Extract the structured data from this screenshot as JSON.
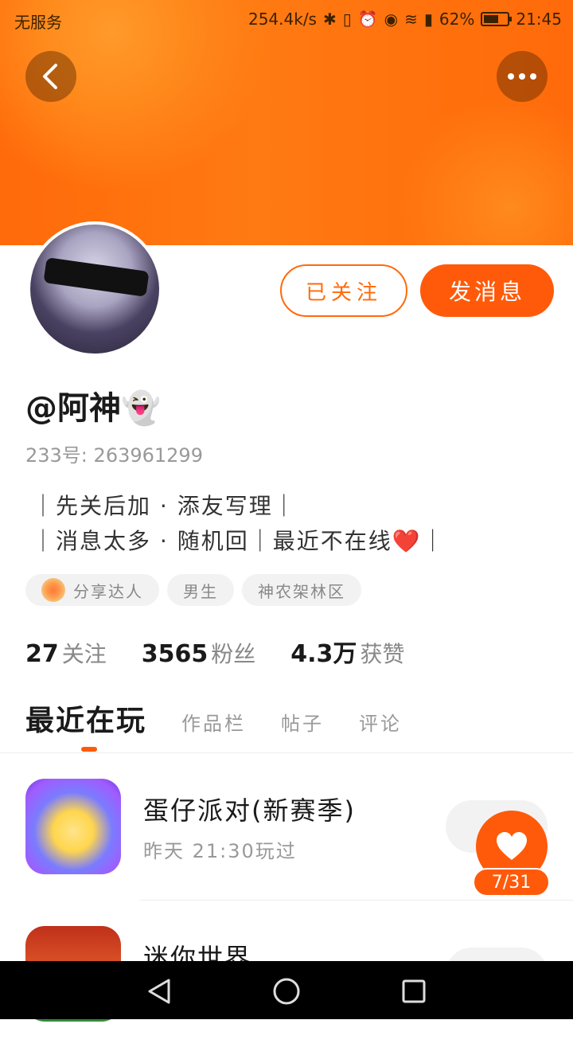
{
  "status_bar": {
    "carrier": "无服务",
    "speed": "254.4k/s",
    "battery": "62%",
    "battery_level": 0.62,
    "time": "21:45"
  },
  "header": {
    "back_icon": "chevron-left-icon",
    "more_icon": "more-horizontal-icon"
  },
  "profile": {
    "follow_label": "已关注",
    "message_label": "发消息",
    "username": "@阿神👻",
    "uid_label": "233号:",
    "uid": "263961299",
    "bio_line1": "｜先关后加 · 添友写理｜",
    "bio_line2": "｜消息太多 · 随机回｜最近不在线❤️｜",
    "tags": [
      "分享达人",
      "男生",
      "神农架林区"
    ],
    "stats": [
      {
        "value": "27",
        "label": "关注"
      },
      {
        "value": "3565",
        "label": "粉丝"
      },
      {
        "value": "4.3万",
        "label": "获赞"
      }
    ]
  },
  "tabs": [
    {
      "label": "最近在玩",
      "active": true
    },
    {
      "label": "作品栏",
      "active": false
    },
    {
      "label": "帖子",
      "active": false
    },
    {
      "label": "评论",
      "active": false
    }
  ],
  "games": [
    {
      "name": "蛋仔派对(新赛季)",
      "time": "昨天 21:30玩过"
    },
    {
      "name": "迷你世界",
      "time": ""
    }
  ],
  "float": {
    "count": "7/31",
    "icon": "heart-icon"
  },
  "colors": {
    "accent": "#ff5a0a",
    "banner": "#ff7a12"
  }
}
